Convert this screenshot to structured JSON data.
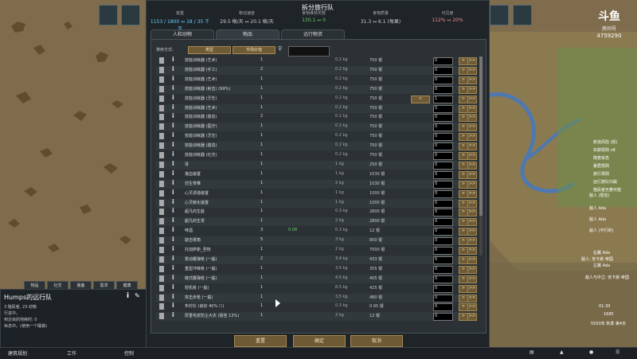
{
  "dialog": {
    "title": "拆分旅行队",
    "stats": [
      {
        "label": "载重",
        "value": "1153 / 1800 ↔ 18 / 35 千克"
      },
      {
        "label": "移动速度",
        "value": "29.5 格/天 ↔ 20.1 格/天"
      },
      {
        "label": "食物维持天数",
        "value": "130.1 ↔ 0"
      },
      {
        "label": "食物质量",
        "value": "31.3 ↔ 6.1 (每果)"
      },
      {
        "label": "可见度",
        "value": "112% ↔ 20%"
      }
    ],
    "tabs": [
      "人和动物",
      "物品",
      "远行物资"
    ],
    "sort_label": "排序方式:",
    "sort_buttons": [
      "类型",
      "市场价值"
    ],
    "search_placeholder": "",
    "footer": {
      "reset": "重置",
      "confirm": "确定",
      "cancel": "取消"
    }
  },
  "rows": [
    {
      "name": "技能训练器 (艺术)",
      "count": "1",
      "change": "",
      "weight": "0.2 kg",
      "value": "750 银",
      "qty": "0"
    },
    {
      "name": "技能训练器 (手工)",
      "count": "2",
      "change": "",
      "weight": "0.2 kg",
      "value": "750 银",
      "qty": "0"
    },
    {
      "name": "技能训练器 (艺术)",
      "count": "1",
      "change": "",
      "weight": "0.2 kg",
      "value": "750 银",
      "qty": "0"
    },
    {
      "name": "技能训练器 (射击) (99%)",
      "count": "1",
      "change": "",
      "weight": "0.2 kg",
      "value": "750 银",
      "qty": "0"
    },
    {
      "name": "技能训练器 (烹饪)",
      "count": "1",
      "change": "",
      "weight": "0.2 kg",
      "value": "750 银",
      "qty": "1"
    },
    {
      "name": "技能训练器 (艺术)",
      "count": "1",
      "change": "",
      "weight": "0.2 kg",
      "value": "750 银",
      "qty": "0"
    },
    {
      "name": "技能训练器 (建造)",
      "count": "2",
      "change": "",
      "weight": "0.2 kg",
      "value": "750 银",
      "qty": "0"
    },
    {
      "name": "技能训练器 (医疗)",
      "count": "1",
      "change": "",
      "weight": "0.2 kg",
      "value": "750 银",
      "qty": "0"
    },
    {
      "name": "技能训练器 (烹饪)",
      "count": "1",
      "change": "",
      "weight": "0.2 kg",
      "value": "750 银",
      "qty": "0"
    },
    {
      "name": "技能训练器 (建造)",
      "count": "1",
      "change": "",
      "weight": "0.2 kg",
      "value": "750 银",
      "qty": "0"
    },
    {
      "name": "技能训练器 (社交)",
      "count": "1",
      "change": "",
      "weight": "0.2 kg",
      "value": "750 银",
      "qty": "0"
    },
    {
      "name": "肾",
      "count": "1",
      "change": "",
      "weight": "1 kg",
      "value": "250 银",
      "qty": "0"
    },
    {
      "name": "凝血装置",
      "count": "1",
      "change": "",
      "weight": "1 kg",
      "value": "1030 银",
      "qty": "0"
    },
    {
      "name": "仿生脊椎",
      "count": "1",
      "change": "",
      "weight": "2 kg",
      "value": "1030 银",
      "qty": "0"
    },
    {
      "name": "心灵调谐装置",
      "count": "1",
      "change": "",
      "weight": "1 kg",
      "value": "1000 银",
      "qty": "0"
    },
    {
      "name": "心灵敏化装置",
      "count": "1",
      "change": "",
      "weight": "1 kg",
      "value": "1000 银",
      "qty": "0"
    },
    {
      "name": "超凡的生脏",
      "count": "1",
      "change": "",
      "weight": "0.3 kg",
      "value": "2800 银",
      "qty": "0"
    },
    {
      "name": "超凡的生胃",
      "count": "1",
      "change": "",
      "weight": "2 kg",
      "value": "2800 银",
      "qty": "0"
    },
    {
      "name": "啤酒",
      "count": "3",
      "change": "0.08",
      "weight": "0.3 kg",
      "value": "12 银",
      "qty": "0"
    },
    {
      "name": "敲击臂角",
      "count": "5",
      "change": "",
      "weight": "3 kg",
      "value": "800 银",
      "qty": "0"
    },
    {
      "name": "托加萨斯_圣物",
      "count": "1",
      "change": "",
      "weight": "2 kg",
      "value": "7000 银",
      "qty": "0"
    },
    {
      "name": "泵动霰弹枪 (一般)",
      "count": "2",
      "change": "",
      "weight": "3.4 kg",
      "value": "433 银",
      "qty": "0"
    },
    {
      "name": "重型冲锋枪 (一般)",
      "count": "1",
      "change": "",
      "weight": "3.5 kg",
      "value": "355 银",
      "qty": "0"
    },
    {
      "name": "链式霰弹枪 (一般)",
      "count": "1",
      "change": "",
      "weight": "4.5 kg",
      "value": "405 银",
      "qty": "0"
    },
    {
      "name": "轻机枪 (一般)",
      "count": "1",
      "change": "",
      "weight": "8.5 kg",
      "value": "425 银",
      "qty": "0"
    },
    {
      "name": "突击步枪 (一般)",
      "count": "1",
      "change": "",
      "weight": "3.5 kg",
      "value": "480 银",
      "qty": "0"
    },
    {
      "name": "布衬衫 (良好 40% ☐)",
      "count": "1",
      "change": "",
      "weight": "0.3 kg",
      "value": "0.95 银",
      "qty": "0"
    },
    {
      "name": "厚重毛皮防尘大衣 (极佳 13%)",
      "count": "1",
      "change": "",
      "weight": "2 kg",
      "value": "12 银",
      "qty": "0"
    }
  ],
  "left_panel": {
    "tabs": [
      "物品",
      "社交",
      "装备",
      "需求",
      "健康"
    ],
    "title": "Humps的远行队",
    "line1": "3 殖民者, 23 动物",
    "line2": "行进中。",
    "line3": "到达目的地耗时: 0",
    "line4": "休息中。(使用一个睡袋)"
  },
  "bottom_bar": [
    "建筑规划",
    "工作",
    "控制"
  ],
  "watermark": {
    "logo": "斗鱼",
    "sub": "房间号",
    "id": "4759290"
  },
  "right_side": {
    "lines": [
      "新流风险 (低)",
      "农耕规则 v8",
      "随意状态",
      "暴君规则",
      "旅行规则",
      "远行旅队归属",
      "殖民者无着可能"
    ],
    "labels": [
      "敌人 (怒态)",
      "敌人 Ada",
      "敌人 Ada",
      "敌人 (平行的)",
      "敌人: 安卡斯 帝国",
      "右翼 Ada",
      "左翼 Ada",
      "敌人与中立: 安卡斯 帝国"
    ],
    "time": "01:30",
    "day": "1685",
    "date": "5503年 秋季 第4天"
  }
}
